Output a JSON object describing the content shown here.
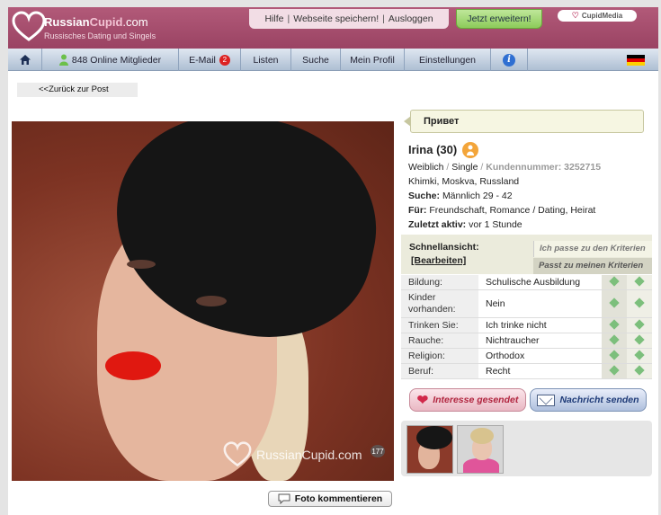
{
  "header": {
    "brand_prefix": "Russian",
    "brand_cupid": "Cupid",
    "brand_suffix": ".com",
    "brand_subtitle": "Russisches Dating und Singels",
    "links": [
      "Hilfe",
      "Webseite speichern!",
      "Ausloggen"
    ],
    "upgrade_label": "Jetzt erweitern!",
    "cupidmedia_label": "CupidMedia"
  },
  "nav": {
    "online_label": "848 Online Mitglieder",
    "email_label": "E-Mail",
    "email_count": "2",
    "items": [
      "Listen",
      "Suche",
      "Mein Profil",
      "Einstellungen"
    ]
  },
  "back_link": "<<Zurück zur Post",
  "photo": {
    "watermark": "RussianCupid.com",
    "photo_number": "177"
  },
  "comment_button": "Foto kommentieren",
  "greeting": "Привет",
  "profile": {
    "name": "Irina (30)",
    "gender": "Weiblich",
    "status": "Single",
    "customer_label": "Kundennummer:",
    "customer_number": "3252715",
    "location": "Khimki, Moskva, Russland",
    "search_label": "Suche:",
    "search_value": "Männlich 29 - 42",
    "for_label": "Für:",
    "for_value": "Freundschaft, Romance / Dating, Heirat",
    "last_active_label": "Zuletzt aktiv:",
    "last_active_value": "vor 1 Stunde"
  },
  "quick_view": {
    "title": "Schnellansicht:",
    "edit": "[Bearbeiten]",
    "criteria_1": "Ich passe zu den Kriterien",
    "criteria_2": "Passt zu meinen Kriterien"
  },
  "details": [
    {
      "label": "Bildung:",
      "value": "Schulische Ausbildung"
    },
    {
      "label": "Kinder vorhanden:",
      "value": "Nein"
    },
    {
      "label": "Trinken Sie:",
      "value": "Ich trinke nicht"
    },
    {
      "label": "Rauche:",
      "value": "Nichtraucher"
    },
    {
      "label": "Religion:",
      "value": "Orthodox"
    },
    {
      "label": "Beruf:",
      "value": "Recht"
    }
  ],
  "actions": {
    "interest": "Interesse gesendet",
    "message": "Nachricht senden"
  },
  "colors": {
    "header": "#a34d6d",
    "nav": "#c2d0e0",
    "match_dot": "#7cbf7c",
    "upgrade": "#9fd66f"
  }
}
